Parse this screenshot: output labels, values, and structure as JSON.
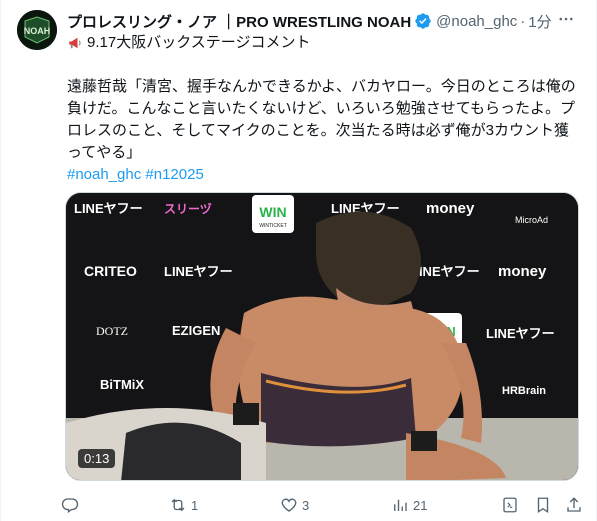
{
  "author": {
    "display_name": "プロレスリング・ノア ｜PRO WRESTLING NOAH",
    "handle": "@noah_ghc",
    "time": "1分",
    "avatar_text": "NOAH",
    "verified_icon": "verified-badge-icon"
  },
  "tweet": {
    "line1": "9.17大阪バックステージコメント",
    "line1_icon": "megaphone-icon",
    "paragraph": "遠藤哲哉「清宮、握手なんかできるかよ、バカヤロー。今日のところは俺の負けだ。こんなこと言いたくないけど、いろいろ勉強させてもらったよ。プロレスのこと、そしてマイクのことを。次当たる時は必ず俺が3カウント獲ってやる」",
    "hashtags": "#noah_ghc #n12025"
  },
  "media": {
    "duration": "0:13",
    "sponsors": {
      "lineyahoo": "LINEヤフー",
      "suri": "スリーヅ",
      "win": "WIN",
      "winsub": "WINTICKET",
      "money": "money",
      "microad": "MicroAd",
      "criteo": "CRITEO",
      "dotz": "DOTZ",
      "ezigen": "EZIGEN",
      "bitmix": "BiTMiX",
      "hrbrain": "HRBrain"
    }
  },
  "actions": {
    "reply_count": "",
    "retweet_count": "1",
    "like_count": "3",
    "views_count": "21"
  },
  "colors": {
    "link": "#1d9bf0",
    "muted": "#536471",
    "text": "#0f1419",
    "verified": "#1d9bf0"
  }
}
